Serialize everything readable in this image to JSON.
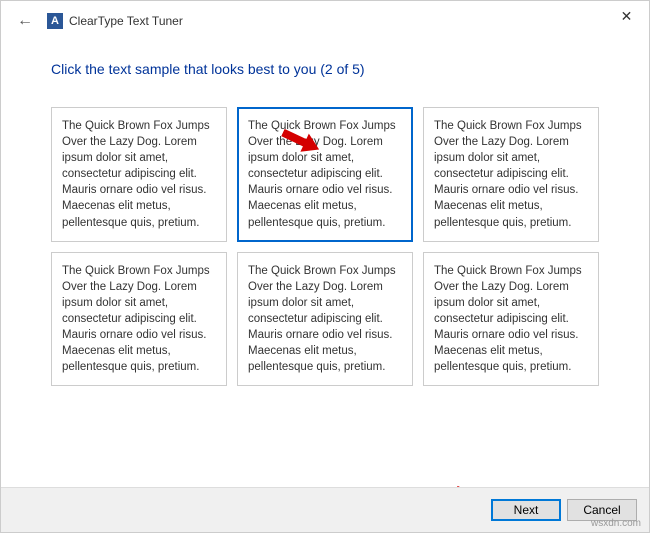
{
  "window": {
    "title": "ClearType Text Tuner",
    "icon_letter": "A"
  },
  "heading": "Click the text sample that looks best to you (2 of 5)",
  "sample_text": "The Quick Brown Fox Jumps Over the Lazy Dog. Lorem ipsum dolor sit amet, consectetur adipiscing elit. Mauris ornare odio vel risus. Maecenas elit metus, pellentesque quis, pretium.",
  "samples": [
    {
      "selected": false
    },
    {
      "selected": true
    },
    {
      "selected": false
    },
    {
      "selected": false
    },
    {
      "selected": false
    },
    {
      "selected": false
    }
  ],
  "footer": {
    "next_label": "Next",
    "cancel_label": "Cancel"
  },
  "step": {
    "current": 2,
    "total": 5
  },
  "watermark": "wsxdn.com"
}
